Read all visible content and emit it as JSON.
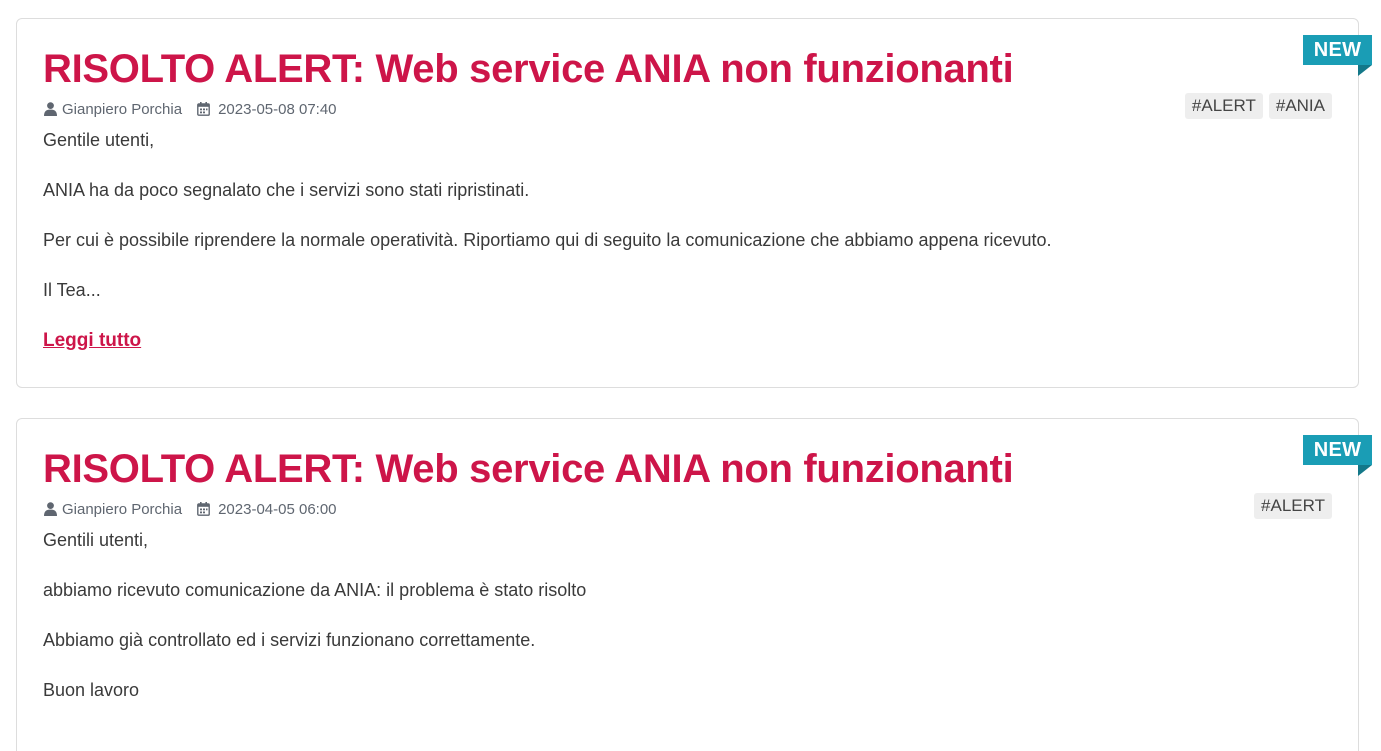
{
  "posts": [
    {
      "title": "RISOLTO ALERT: Web service ANIA non funzionanti",
      "author": "Gianpiero Porchia",
      "date": "2023-05-08 07:40",
      "badge": "NEW",
      "tags": [
        "#ALERT",
        "#ANIA"
      ],
      "paragraphs": [
        "Gentile utenti,",
        "ANIA ha da poco segnalato che i servizi sono stati ripristinati.",
        "Per cui è possibile riprendere la normale operatività. Riportiamo qui di seguito la comunicazione che abbiamo appena ricevuto.",
        "Il Tea..."
      ],
      "read_more": "Leggi tutto"
    },
    {
      "title": "RISOLTO ALERT: Web service ANIA non funzionanti",
      "author": "Gianpiero Porchia",
      "date": "2023-04-05 06:00",
      "badge": "NEW",
      "tags": [
        "#ALERT"
      ],
      "paragraphs": [
        "Gentili utenti,",
        "abbiamo ricevuto comunicazione da ANIA: il problema è stato risolto",
        "Abbiamo già controllato ed i servizi funzionano correttamente.",
        "Buon lavoro"
      ]
    }
  ],
  "icons": {
    "author": "user-icon",
    "date": "calendar-icon"
  },
  "colors": {
    "title": "#cd1549",
    "ribbon": "#1a9db5",
    "tag_bg": "#eeeeee"
  }
}
